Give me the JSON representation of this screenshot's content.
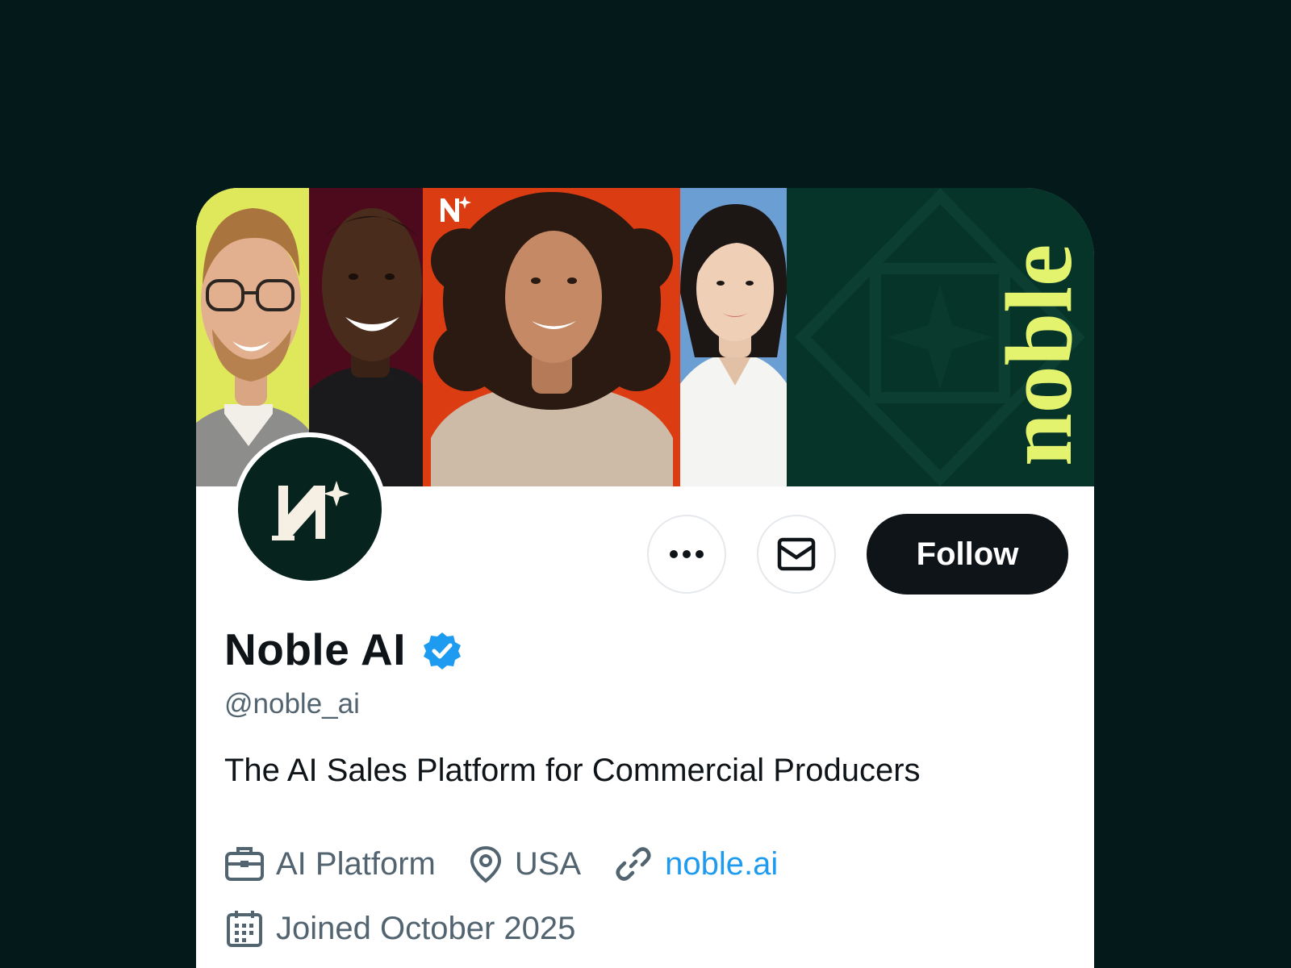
{
  "banner": {
    "panels": [
      {
        "name": "portrait-man-glasses",
        "color": "#dfe85a"
      },
      {
        "name": "portrait-man-smiling",
        "color": "#4e0a1d"
      },
      {
        "name": "portrait-woman-curly-hair",
        "color": "#dc3c12"
      },
      {
        "name": "portrait-woman-short-hair",
        "color": "#6b9fd3"
      },
      {
        "name": "brand-wordmark-panel",
        "color": "#063429"
      }
    ],
    "wordmark": "noble"
  },
  "profile": {
    "name": "Noble AI",
    "handle": "@noble_ai",
    "bio": "The AI Sales Platform for Commercial Producers",
    "verified": true,
    "category": "AI Platform",
    "location": "USA",
    "website": "noble.ai",
    "joined": "Joined October 2025"
  },
  "actions": {
    "follow_label": "Follow",
    "more_icon": "more-horizontal-icon",
    "message_icon": "envelope-icon"
  },
  "colors": {
    "background": "#03191a",
    "brand_dark": "#07231d",
    "accent_lime": "#e3f36e",
    "link": "#1d9bf0",
    "verified": "#1d9bf0",
    "follow_button": "#0f1419"
  }
}
